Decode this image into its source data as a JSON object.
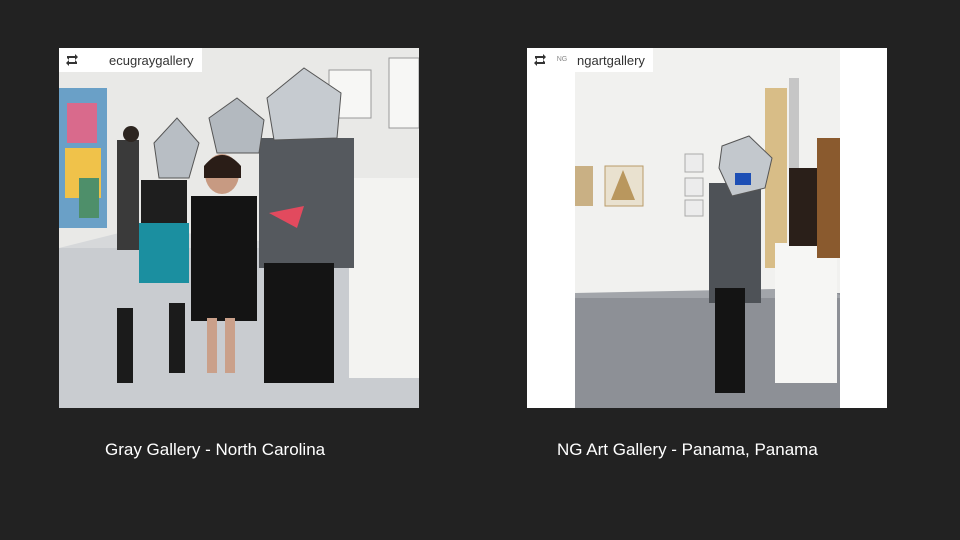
{
  "photos": [
    {
      "repost_icon": "repost-icon",
      "account": "ecugraygallery",
      "caption": "Gray Gallery - North Carolina"
    },
    {
      "repost_icon": "repost-icon",
      "account": "ngartgallery",
      "avatar_text": "NG",
      "caption": "NG Art Gallery -  Panama,  Panama"
    }
  ],
  "colors": {
    "background": "#222222",
    "caption_text": "#ffffff",
    "tag_background": "#ffffff"
  }
}
